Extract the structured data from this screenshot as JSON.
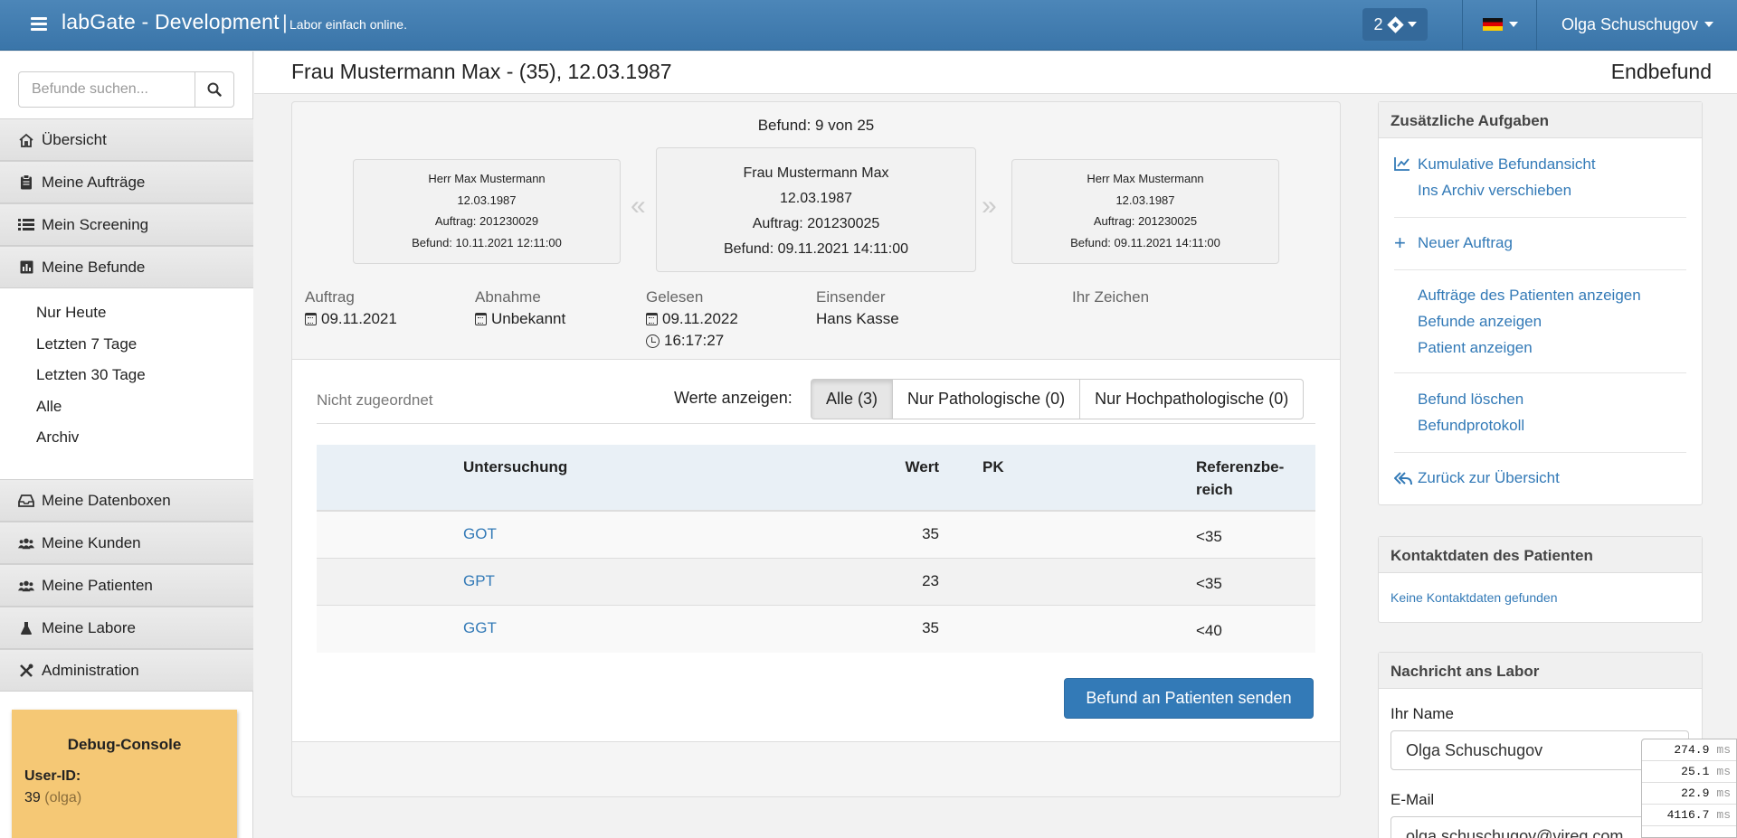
{
  "topbar": {
    "brand": "labGate - Development",
    "separator": "|",
    "tagline": "Labor einfach online.",
    "badge_count": "2",
    "user_name": "Olga Schuschugov"
  },
  "sidebar": {
    "search_placeholder": "Befunde suchen...",
    "nav": [
      {
        "label": "Übersicht",
        "icon": "home-icon"
      },
      {
        "label": "Meine Aufträge",
        "icon": "clipboard-icon"
      },
      {
        "label": "Mein Screening",
        "icon": "list-icon"
      },
      {
        "label": "Meine Befunde",
        "icon": "bar-chart-icon"
      },
      {
        "label": "Meine Datenboxen",
        "icon": "inbox-icon"
      },
      {
        "label": "Meine Kunden",
        "icon": "users-icon"
      },
      {
        "label": "Meine Patienten",
        "icon": "users-icon"
      },
      {
        "label": "Meine Labore",
        "icon": "flask-icon"
      },
      {
        "label": "Administration",
        "icon": "tools-icon"
      }
    ],
    "sub_items": [
      "Nur Heute",
      "Letzten 7 Tage",
      "Letzten 30 Tage",
      "Alle",
      "Archiv"
    ],
    "debug": {
      "title": "Debug-Console",
      "user_label": "User-ID:",
      "user_id": "39",
      "user_alias": "(olga)"
    }
  },
  "header": {
    "patient": "Frau Mustermann Max - (35), 12.03.1987",
    "status": "Endbefund"
  },
  "befund": {
    "counter": "Befund: 9 von 25",
    "cards": {
      "prev": {
        "name": "Herr Max Mustermann",
        "dob": "12.03.1987",
        "auftrag": "Auftrag: 201230029",
        "befund": "Befund: 10.11.2021 12:11:00"
      },
      "current": {
        "name": "Frau Mustermann Max",
        "dob": "12.03.1987",
        "auftrag": "Auftrag: 201230025",
        "befund": "Befund: 09.11.2021 14:11:00"
      },
      "next": {
        "name": "Herr Max Mustermann",
        "dob": "12.03.1987",
        "auftrag": "Auftrag: 201230025",
        "befund": "Befund: 09.11.2021 14:11:00"
      }
    },
    "arrows": {
      "prev": "«",
      "next": "»"
    },
    "meta": {
      "auftrag_label": "Auftrag",
      "auftrag_value": "09.11.2021",
      "abnahme_label": "Abnahme",
      "abnahme_value": "Unbekannt",
      "gelesen_label": "Gelesen",
      "gelesen_date": "09.11.2022",
      "gelesen_time": "16:17:27",
      "einsender_label": "Einsender",
      "einsender_value": "Hans Kasse",
      "zeichen_label": "Ihr Zeichen"
    },
    "unassigned": "Nicht zugeordnet",
    "filter_label": "Werte anzeigen:",
    "filters": [
      "Alle (3)",
      "Nur Pathologische (0)",
      "Nur Hochpathologische (0)"
    ],
    "table": {
      "headers": {
        "name": "Untersuchung",
        "value": "Wert",
        "pk": "PK",
        "ref_line1": "Referenzbe-",
        "ref_line2": "reich"
      },
      "rows": [
        {
          "name": "GOT",
          "value": "35",
          "pk": "",
          "ref": "<35"
        },
        {
          "name": "GPT",
          "value": "23",
          "pk": "",
          "ref": "<35"
        },
        {
          "name": "GGT",
          "value": "35",
          "pk": "",
          "ref": "<40"
        }
      ]
    },
    "send_button": "Befund an Patienten senden"
  },
  "right": {
    "tasks_title": "Zusätzliche Aufgaben",
    "tasks": {
      "kumulativ": "Kumulative Befundansicht",
      "archiv": "Ins Archiv verschieben",
      "neuer_auftrag": "Neuer Auftrag",
      "auftraege_patient": "Aufträge des Patienten anzeigen",
      "befunde_anzeigen": "Befunde anzeigen",
      "patient_anzeigen": "Patient anzeigen",
      "befund_loeschen": "Befund löschen",
      "befundprotokoll": "Befundprotokoll",
      "zurueck": "Zurück zur Übersicht"
    },
    "contact_title": "Kontaktdaten des Patienten",
    "contact_none": "Keine Kontaktdaten gefunden",
    "message_title": "Nachricht ans Labor",
    "name_label": "Ihr Name",
    "name_value": "Olga Schuschugov",
    "email_label": "E-Mail",
    "email_value": "olga.schuschugov@vireq.com"
  },
  "timings": [
    {
      "value": "274.9",
      "unit": "ms"
    },
    {
      "value": "25.1",
      "unit": "ms"
    },
    {
      "value": "22.9",
      "unit": "ms"
    },
    {
      "value": "4116.7",
      "unit": "ms"
    }
  ]
}
